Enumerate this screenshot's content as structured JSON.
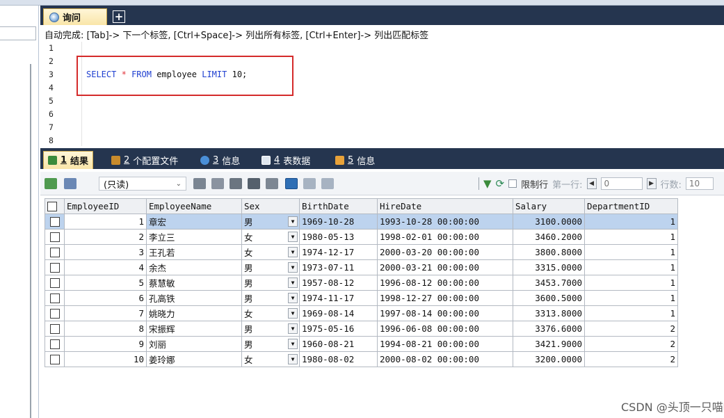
{
  "query_tab": {
    "label": "询问",
    "add_label": "+"
  },
  "hint": "自动完成: [Tab]-> 下一个标签, [Ctrl+Space]-> 列出所有标签, [Ctrl+Enter]-> 列出匹配标签",
  "editor": {
    "line_numbers": [
      "1",
      "2",
      "3",
      "4",
      "5",
      "6",
      "7",
      "8"
    ],
    "sql": {
      "kw1": "SELECT",
      "star": "*",
      "kw2": "FROM",
      "table": "employee",
      "kw3": "LIMIT",
      "limit_value": "10;"
    }
  },
  "result_tabs": [
    {
      "num": "1",
      "label": "结果"
    },
    {
      "num": "2",
      "label": "个配置文件"
    },
    {
      "num": "3",
      "label": "信息"
    },
    {
      "num": "4",
      "label": "表数据"
    },
    {
      "num": "5",
      "label": "信息"
    }
  ],
  "toolbar": {
    "readonly_label": "(只读)",
    "limit_rows_label": "限制行",
    "first_row_label": "第一行:",
    "first_row_value": "0",
    "rows_label": "行数:",
    "rows_value": "10"
  },
  "grid": {
    "columns": [
      "EmployeeID",
      "EmployeeName",
      "Sex",
      "BirthDate",
      "HireDate",
      "Salary",
      "DepartmentID"
    ],
    "rows": [
      [
        "1",
        "章宏",
        "男",
        "1969-10-28",
        "1993-10-28 00:00:00",
        "3100.0000",
        "1"
      ],
      [
        "2",
        "李立三",
        "女",
        "1980-05-13",
        "1998-02-01 00:00:00",
        "3460.2000",
        "1"
      ],
      [
        "3",
        "王孔若",
        "女",
        "1974-12-17",
        "2000-03-20 00:00:00",
        "3800.8000",
        "1"
      ],
      [
        "4",
        "余杰",
        "男",
        "1973-07-11",
        "2000-03-21 00:00:00",
        "3315.0000",
        "1"
      ],
      [
        "5",
        "蔡慧敏",
        "男",
        "1957-08-12",
        "1996-08-12 00:00:00",
        "3453.7000",
        "1"
      ],
      [
        "6",
        "孔高铁",
        "男",
        "1974-11-17",
        "1998-12-27 00:00:00",
        "3600.5000",
        "1"
      ],
      [
        "7",
        "姚晓力",
        "女",
        "1969-08-14",
        "1997-08-14 00:00:00",
        "3313.8000",
        "1"
      ],
      [
        "8",
        "宋振辉",
        "男",
        "1975-05-16",
        "1996-06-08 00:00:00",
        "3376.6000",
        "2"
      ],
      [
        "9",
        "刘丽",
        "男",
        "1960-08-21",
        "1994-08-21 00:00:00",
        "3421.9000",
        "2"
      ],
      [
        "10",
        "姜玲娜",
        "女",
        "1980-08-02",
        "2000-08-02 00:00:00",
        "3200.0000",
        "2"
      ]
    ]
  },
  "watermark": "CSDN @头顶一只喵喵",
  "colors": {
    "tabbar": "#25354f",
    "keyword": "#1f3fd0",
    "highlight": "#d42a2a",
    "selected_row": "#bdd3ee"
  }
}
